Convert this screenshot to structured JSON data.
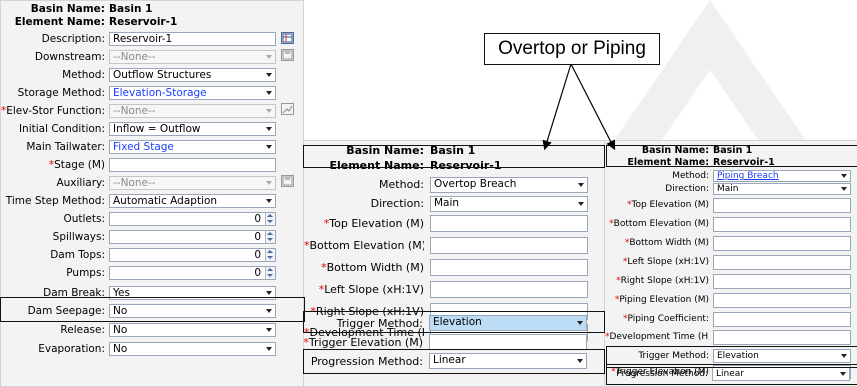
{
  "callout": "Overtop or Piping",
  "panel_reservoir": {
    "basin_name_label": "Basin Name:",
    "basin_name": "Basin 1",
    "element_name_label": "Element Name:",
    "element_name": "Reservoir-1",
    "description_label": "Description:",
    "description": "Reservoir-1",
    "downstream_label": "Downstream:",
    "downstream": "--None--",
    "method_label": "Method:",
    "method": "Outflow Structures",
    "storage_method_label": "Storage Method:",
    "storage_method": "Elevation-Storage",
    "elev_stor_label": "Elev-Stor Function:",
    "elev_stor": "--None--",
    "initial_condition_label": "Initial Condition:",
    "initial_condition": "Inflow = Outflow",
    "main_tailwater_label": "Main Tailwater:",
    "main_tailwater": "Fixed Stage",
    "stage_label": "Stage (M)",
    "stage": "",
    "auxiliary_label": "Auxiliary:",
    "auxiliary": "--None--",
    "time_step_label": "Time Step Method:",
    "time_step": "Automatic Adaption",
    "outlets_label": "Outlets:",
    "outlets": "0",
    "spillways_label": "Spillways:",
    "spillways": "0",
    "dam_tops_label": "Dam Tops:",
    "dam_tops": "0",
    "pumps_label": "Pumps:",
    "pumps": "0",
    "dam_break_label": "Dam Break:",
    "dam_break": "Yes",
    "dam_seepage_label": "Dam Seepage:",
    "dam_seepage": "No",
    "release_label": "Release:",
    "release": "No",
    "evaporation_label": "Evaporation:",
    "evaporation": "No"
  },
  "panel_overtop": {
    "basin_name_label": "Basin Name:",
    "basin_name": "Basin 1",
    "element_name_label": "Element Name:",
    "element_name": "Reservoir-1",
    "method_label": "Method:",
    "method": "Overtop Breach",
    "direction_label": "Direction:",
    "direction": "Main",
    "top_elev_label": "Top Elevation (M)",
    "bottom_elev_label": "Bottom Elevation (M)",
    "bottom_width_label": "Bottom Width (M)",
    "left_slope_label": "Left Slope (xH:1V)",
    "right_slope_label": "Right Slope (xH:1V)",
    "dev_time_label": "Development Time (HR)",
    "trigger_method_label": "Trigger Method:",
    "trigger_method": "Elevation",
    "trigger_elev_label": "Trigger Elevation (M)",
    "progression_label": "Progression Method:",
    "progression": "Linear"
  },
  "panel_piping": {
    "basin_name_label": "Basin Name:",
    "basin_name": "Basin 1",
    "element_name_label": "Element Name:",
    "element_name": "Reservoir-1",
    "method_label": "Method:",
    "method": "Piping Breach",
    "direction_label": "Direction:",
    "direction": "Main",
    "top_elev_label": "Top Elevation (M)",
    "bottom_elev_label": "Bottom Elevation (M)",
    "bottom_width_label": "Bottom Width (M)",
    "left_slope_label": "Left Slope (xH:1V)",
    "right_slope_label": "Right Slope (xH:1V)",
    "piping_elev_label": "Piping Elevation (M)",
    "piping_coef_label": "Piping Coefficient:",
    "dev_time_label": "Development Time (HR)",
    "trigger_method_label": "Trigger Method:",
    "trigger_method": "Elevation",
    "trigger_elev_label": "Trigger Elevation (M)",
    "progression_label": "Progression Method:",
    "progression": "Linear"
  },
  "required_marker": "*",
  "icons": {
    "description_button": "table-icon",
    "downstream_button": "save-icon",
    "elev_stor_button": "graph-icon",
    "auxiliary_button": "save-icon"
  }
}
